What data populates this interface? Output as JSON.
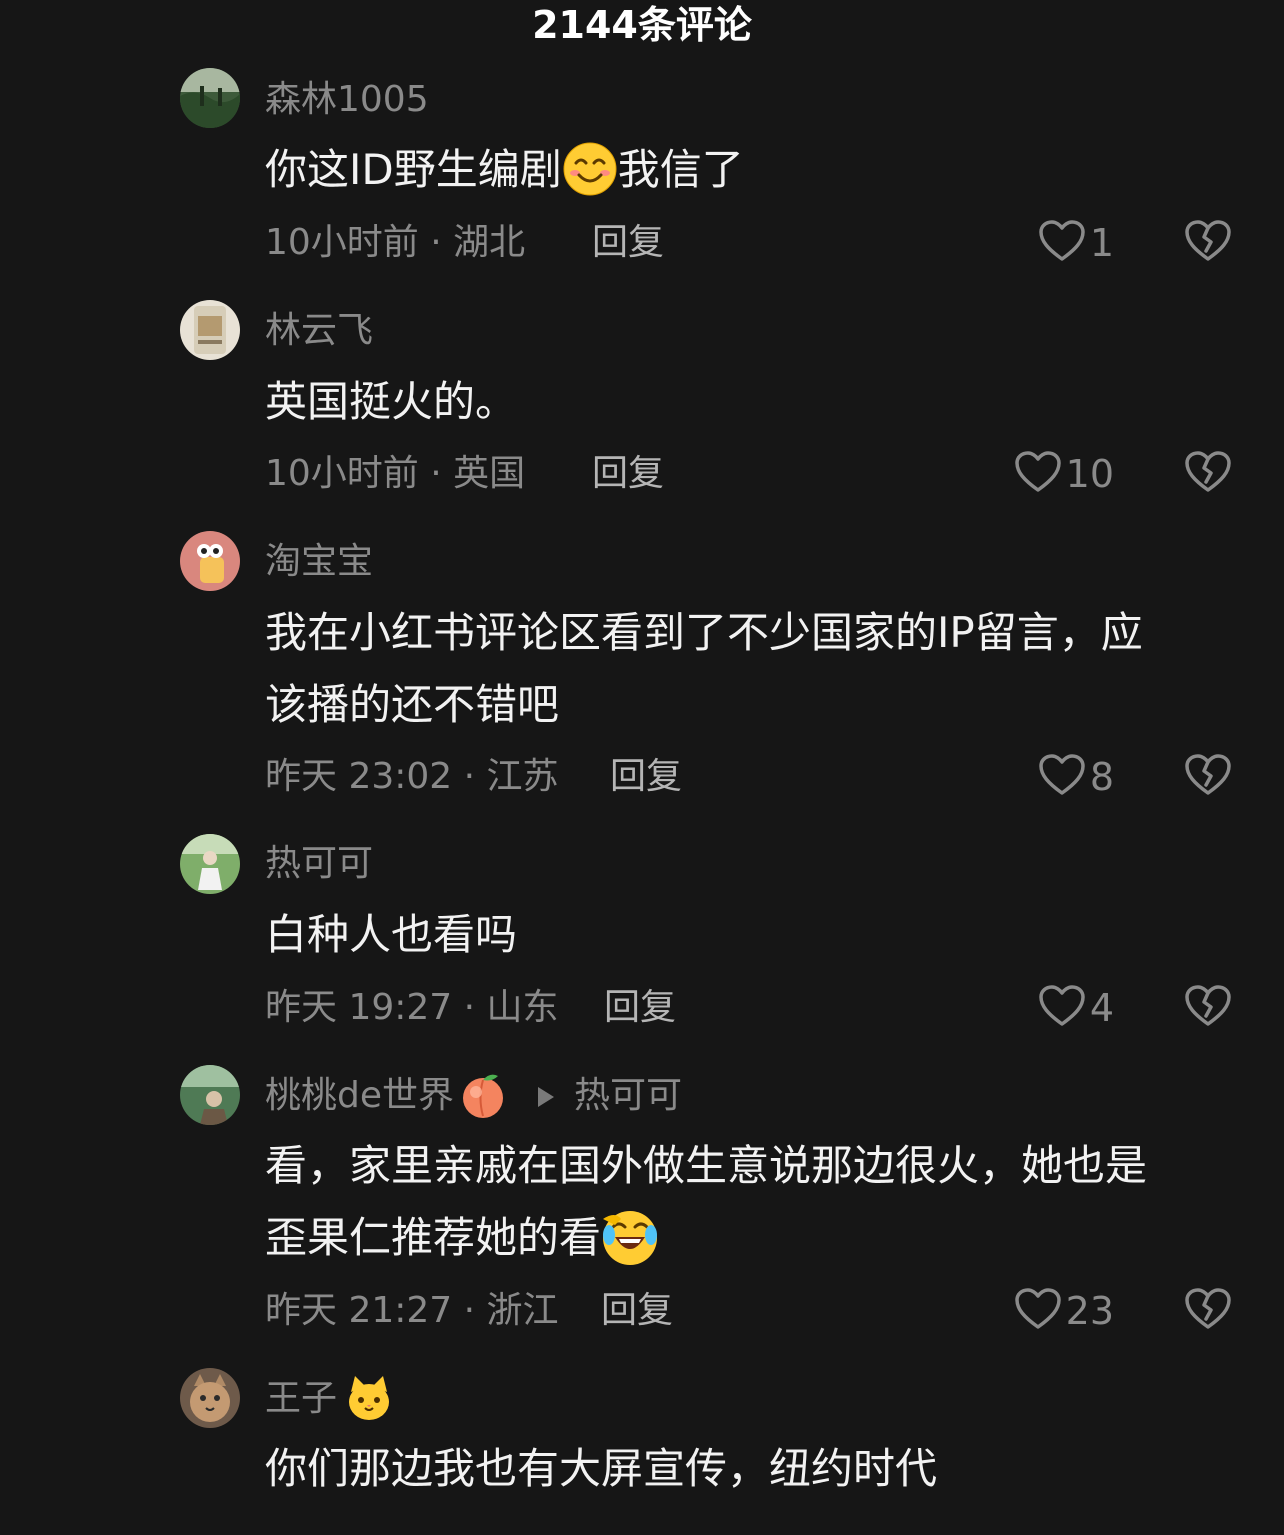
{
  "header": {
    "title": "2144条评论"
  },
  "reply_label": "回复",
  "comments": [
    {
      "username": "森林1005",
      "text_lines": [
        "你这ID野生编剧",
        "我信了"
      ],
      "emoji": "smiling-face-icon",
      "time": "10小时前",
      "location": "湖北",
      "likes": "1"
    },
    {
      "username": "林云飞",
      "text_lines": [
        "英国挺火的。"
      ],
      "time": "10小时前",
      "location": "英国",
      "likes": "10"
    },
    {
      "username": "淘宝宝",
      "text_lines": [
        "我在小红书评论区看到了不少国家的IP留言，应",
        "该播的还不错吧"
      ],
      "time": "昨天 23:02",
      "location": "江苏",
      "likes": "8"
    },
    {
      "username": "热可可",
      "text_lines": [
        "白种人也看吗"
      ],
      "time": "昨天 19:27",
      "location": "山东",
      "likes": "4"
    },
    {
      "username": "桃桃de世界",
      "username_emoji": "peach-icon",
      "reply_to": "热可可",
      "text_lines": [
        "看，家里亲戚在国外做生意说那边很火，她也是",
        "歪果仁推荐她的看"
      ],
      "emoji": "rolling-laughing-face-icon",
      "time": "昨天 21:27",
      "location": "浙江",
      "likes": "23"
    },
    {
      "username": "王子",
      "username_emoji": "cat-face-icon",
      "text_lines": [
        "你们那边我也有大屏宣传，纽约时代"
      ]
    }
  ],
  "colors": {
    "background": "#161616",
    "text_primary": "#f2f2f2",
    "text_secondary": "#8a8a8a"
  }
}
